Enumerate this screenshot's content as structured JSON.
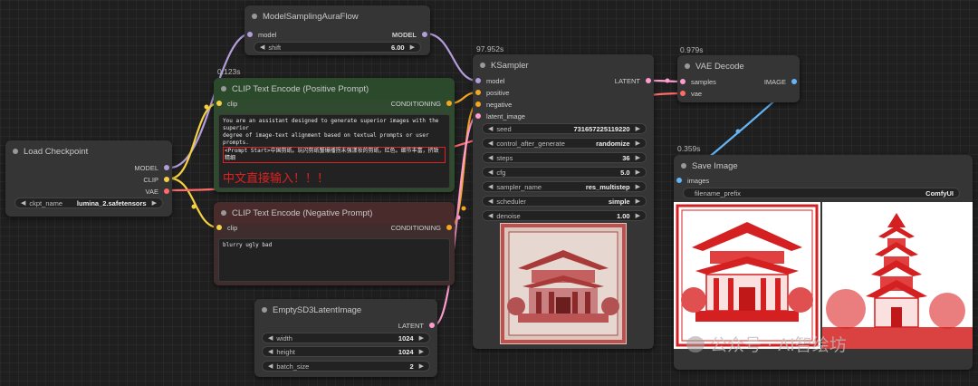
{
  "colors": {
    "model": "#b39ddb",
    "clip": "#f5d142",
    "vae": "#ff6b6b",
    "conditioning": "#f5a623",
    "latent": "#ff9ccf",
    "image": "#64b5f6"
  },
  "model_sampling": {
    "title": "ModelSamplingAuraFlow",
    "in_model": "model",
    "out_model": "MODEL",
    "shift_label": "shift",
    "shift_value": "6.00"
  },
  "load_checkpoint": {
    "title": "Load Checkpoint",
    "out_model": "MODEL",
    "out_clip": "CLIP",
    "out_vae": "VAE",
    "ckpt_label": "ckpt_name",
    "ckpt_value": "lumina_2.safetensors"
  },
  "clip_pos": {
    "timing": "0.123s",
    "title": "CLIP Text Encode (Positive Prompt)",
    "in_clip": "clip",
    "out": "CONDITIONING",
    "text_line1": "You are an assistant designed to generate superior images with the superior",
    "text_line2": "degree of image-text alignment based on textual prompts or user prompts.",
    "text_line3": "<Prompt Start>中国剪纸。玩闪剪纸蟹爆播拐未强漾妆的剪纸，红色。细节丰富，挤致",
    "text_line4": "精细",
    "annotation": "中文直接输入！！！"
  },
  "clip_neg": {
    "title": "CLIP Text Encode (Negative Prompt)",
    "in_clip": "clip",
    "out": "CONDITIONING",
    "text": "blurry ugly bad"
  },
  "empty_latent": {
    "title": "EmptySD3LatentImage",
    "out": "LATENT",
    "width_label": "width",
    "width_value": "1024",
    "height_label": "height",
    "height_value": "1024",
    "batch_label": "batch_size",
    "batch_value": "2"
  },
  "ksampler": {
    "timing": "97.952s",
    "title": "KSampler",
    "in_model": "model",
    "in_positive": "positive",
    "in_negative": "negative",
    "in_latent": "latent_image",
    "out": "LATENT",
    "seed_label": "seed",
    "seed_value": "731657225119220",
    "control_label": "control_after_generate",
    "control_value": "randomize",
    "steps_label": "steps",
    "steps_value": "36",
    "cfg_label": "cfg",
    "cfg_value": "5.0",
    "sampler_label": "sampler_name",
    "sampler_value": "res_multistep",
    "scheduler_label": "scheduler",
    "scheduler_value": "simple",
    "denoise_label": "denoise",
    "denoise_value": "1.00"
  },
  "vae_decode": {
    "timing": "0.979s",
    "title": "VAE Decode",
    "in_samples": "samples",
    "in_vae": "vae",
    "out": "IMAGE"
  },
  "save_image": {
    "timing": "0.359s",
    "title": "Save Image",
    "in_images": "images",
    "prefix_label": "filename_prefix",
    "prefix_value": "ComfyUI"
  },
  "watermark": "公众号 · AI智绘坊"
}
